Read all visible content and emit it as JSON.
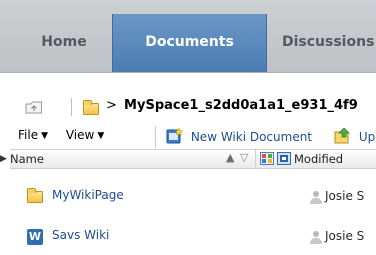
{
  "tabs": [
    {
      "label": "Home",
      "selected": false
    },
    {
      "label": "Documents",
      "selected": true
    },
    {
      "label": "Discussions",
      "selected": false
    }
  ],
  "breadcrumb": {
    "separator": ">",
    "path_label": "MySpace1_s2dd0a1a1_e931_4f9"
  },
  "toolbar": {
    "file_label": "File",
    "view_label": "View",
    "new_wiki_label": "New Wiki Document",
    "upload_label": "Up"
  },
  "table": {
    "columns": {
      "name": "Name",
      "modified_by": "Modified"
    },
    "rows": [
      {
        "name": "MyWikiPage",
        "type_icon": "folder-icon",
        "modified_by": "Josie S"
      },
      {
        "name": "Savs Wiki",
        "type_icon": "wiki-icon",
        "modified_by": "Josie S"
      }
    ]
  },
  "colors": {
    "selected_tab": "#5b89bd",
    "tabbar_bg": "#c6cacd",
    "link": "#1f4d93"
  }
}
